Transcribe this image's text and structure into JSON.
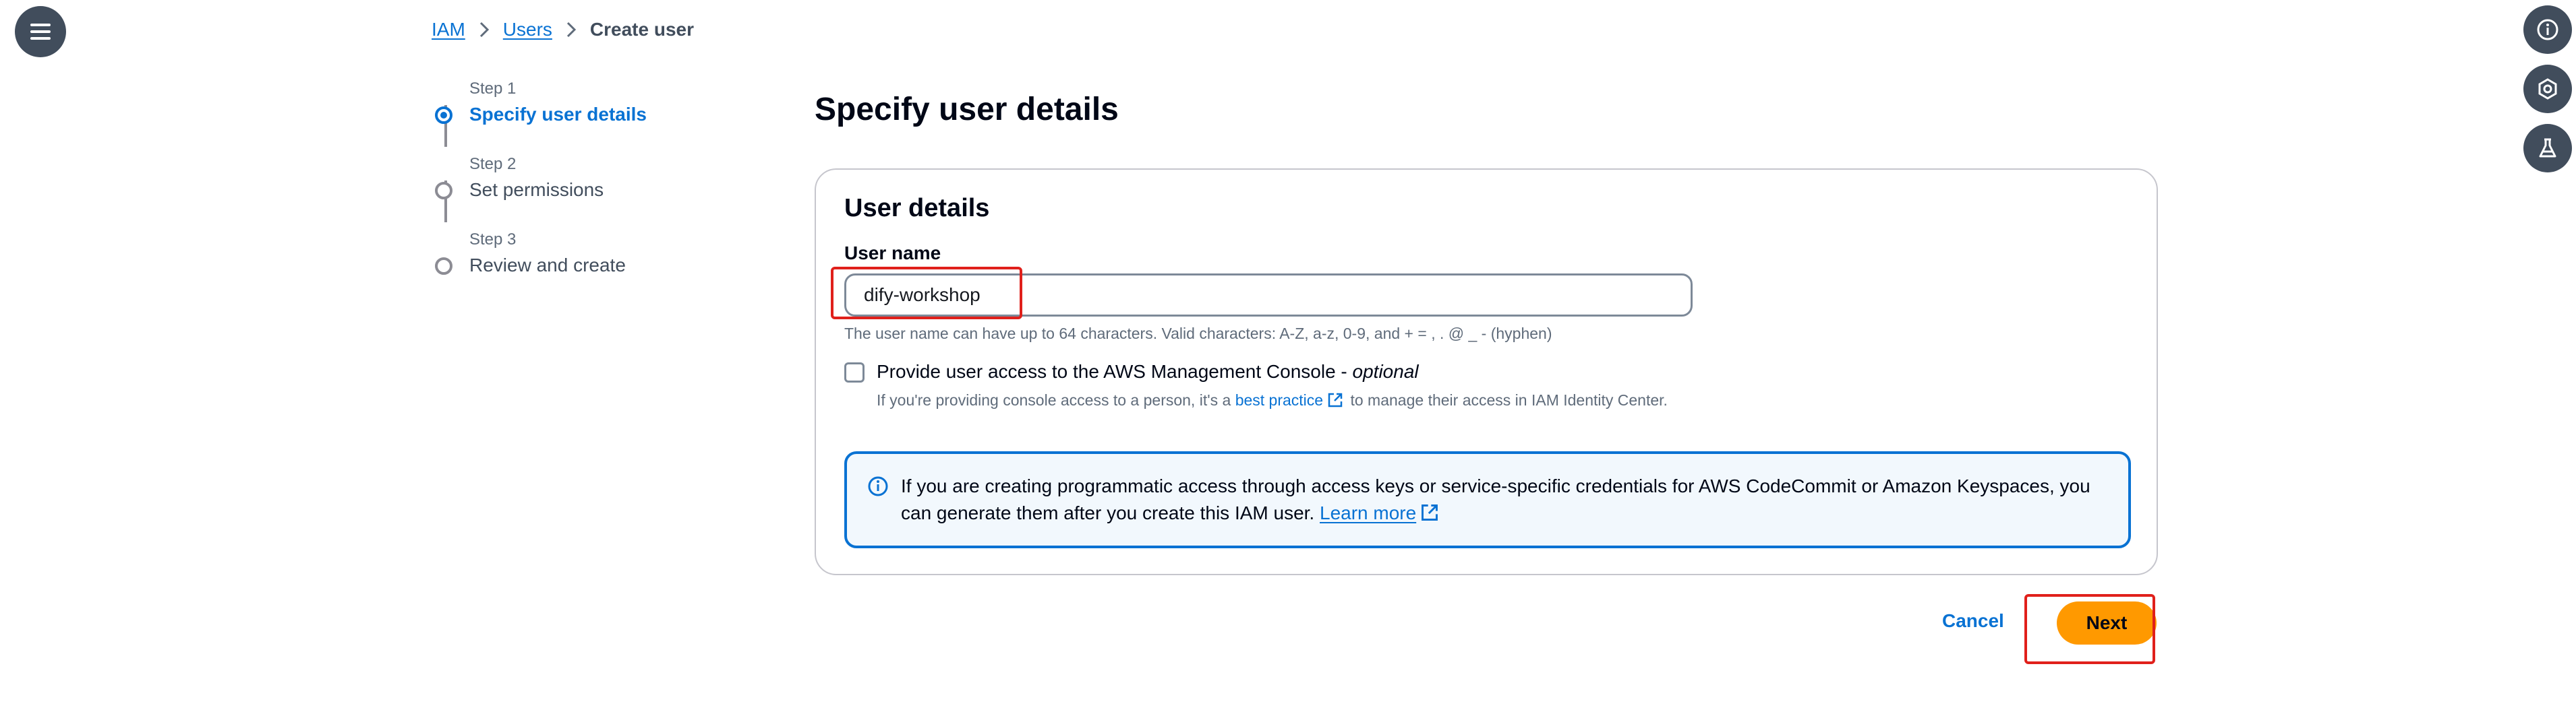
{
  "breadcrumb": {
    "items": [
      "IAM",
      "Users"
    ],
    "current": "Create user"
  },
  "steps": [
    {
      "num": "Step 1",
      "title": "Specify user details"
    },
    {
      "num": "Step 2",
      "title": "Set permissions"
    },
    {
      "num": "Step 3",
      "title": "Review and create"
    }
  ],
  "page_title": "Specify user details",
  "panel": {
    "title": "User details",
    "username_label": "User name",
    "username_value": "dify-workshop",
    "username_hint": "The user name can have up to 64 characters. Valid characters: A-Z, a-z, 0-9, and + = , . @ _ - (hyphen)",
    "console_access_label": "Provide user access to the AWS Management Console - ",
    "console_access_optional": "optional",
    "console_access_desc_before": "If you're providing console access to a person, it's a ",
    "console_access_link": "best practice",
    "console_access_desc_after": " to manage their access in IAM Identity Center.",
    "info_text": "If you are creating programmatic access through access keys or service-specific credentials for AWS CodeCommit or Amazon Keyspaces, you can generate them after you create this IAM user. ",
    "info_link": "Learn more"
  },
  "actions": {
    "cancel": "Cancel",
    "next": "Next"
  },
  "colors": {
    "accent": "#0972d3",
    "primary_button": "#ff9900",
    "annotation": "#e0201b"
  },
  "icons": {
    "menu": "hamburger-menu-icon",
    "tools": [
      "info-icon",
      "hexagon-icon",
      "flask-icon"
    ]
  }
}
